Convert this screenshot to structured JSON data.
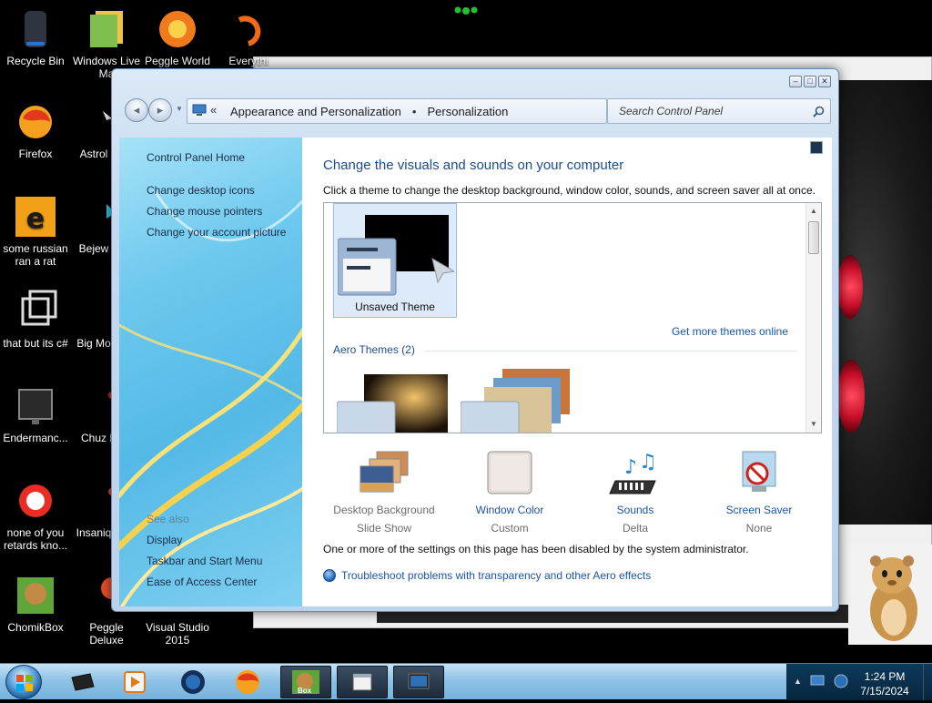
{
  "desktop": {
    "icons": [
      {
        "label": "Recycle Bin",
        "icon": "recycle-bin-icon"
      },
      {
        "label": "Windows Live Ma",
        "icon": "windows-live-icon"
      },
      {
        "label": "Peggle World",
        "icon": "peggle-world-icon"
      },
      {
        "label": "Everythi",
        "icon": "everything-icon"
      },
      {
        "label": "Firefox",
        "icon": "firefox-icon"
      },
      {
        "label": "Astrol Delu",
        "icon": "astrol-icon"
      },
      {
        "label": "some russian ran a rat",
        "icon": "russian-file-icon"
      },
      {
        "label": "Bejew Delu",
        "icon": "bejeweled-icon"
      },
      {
        "label": "that but its c#",
        "icon": "shortcut-icon"
      },
      {
        "label": "Big Mo Delu",
        "icon": "big-money-icon"
      },
      {
        "label": "Endermanc...",
        "icon": "endermanch-icon"
      },
      {
        "label": "Chuz Delu",
        "icon": "chuzzle-icon"
      },
      {
        "label": "none of you retards kno...",
        "icon": "none-of-you-icon"
      },
      {
        "label": "Insaniq Delu",
        "icon": "insaniquarium-icon"
      },
      {
        "label": "ChomikBox",
        "icon": "chomikbox-icon"
      },
      {
        "label": "Peggle Deluxe",
        "icon": "peggle-deluxe-icon"
      },
      {
        "label": "Visual Studio 2015",
        "icon": "visual-studio-icon"
      }
    ]
  },
  "window": {
    "breadcrumb": [
      "Appearance and Personalization",
      "Personalization"
    ],
    "breadcrumb_sep": "•",
    "search_placeholder": "Search Control Panel",
    "sidebar": {
      "home": "Control Panel Home",
      "links": [
        "Change desktop icons",
        "Change mouse pointers",
        "Change your account picture"
      ],
      "see_also": "See also",
      "see_also_links": [
        "Display",
        "Taskbar and Start Menu",
        "Ease of Access Center"
      ]
    },
    "heading": "Change the visuals and sounds on your computer",
    "subtext": "Click a theme to change the desktop background, window color, sounds, and screen saver all at once.",
    "themes": {
      "selected_name": "Unsaved Theme",
      "more_online": "Get more themes online",
      "aero_label": "Aero Themes (2)"
    },
    "bottom_items": [
      {
        "name": "Desktop Background",
        "value": "Slide Show",
        "icon": "desktop-background-icon",
        "disabled": true
      },
      {
        "name": "Window Color",
        "value": "Custom",
        "icon": "window-color-icon",
        "disabled": false
      },
      {
        "name": "Sounds",
        "value": "Delta",
        "icon": "sounds-icon",
        "disabled": false
      },
      {
        "name": "Screen Saver",
        "value": "None",
        "icon": "screen-saver-icon",
        "disabled": false
      }
    ],
    "disabled_message": "One or more of the settings on this page has been disabled by the system administrator.",
    "troubleshoot": "Troubleshoot problems with transparency and other Aero effects"
  },
  "taskbar": {
    "time": "1:24 PM",
    "date": "7/15/2024",
    "chomik_label": "Box"
  }
}
